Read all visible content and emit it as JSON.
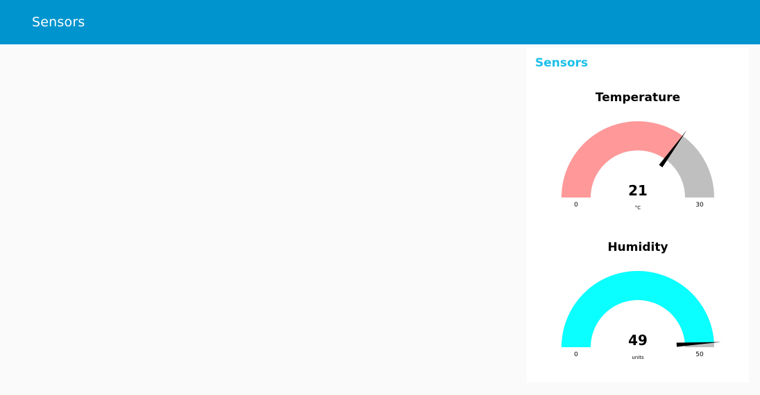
{
  "app": {
    "title": "Sensors"
  },
  "group": {
    "title": "Sensors"
  },
  "gauges": [
    {
      "title": "Temperature",
      "value": 21,
      "value_label": "21",
      "unit": "°C",
      "min": 0,
      "max": 30,
      "min_label": "0",
      "max_label": "30",
      "fill_color": "#ff9999",
      "track_color": "#bfbfbf",
      "needle_color": "#000000"
    },
    {
      "title": "Humidity",
      "value": 49,
      "value_label": "49",
      "unit": "units",
      "min": 0,
      "max": 50,
      "min_label": "0",
      "max_label": "50",
      "fill_color": "#0affff",
      "track_color": "#bfbfbf",
      "needle_color": "#000000"
    }
  ]
}
